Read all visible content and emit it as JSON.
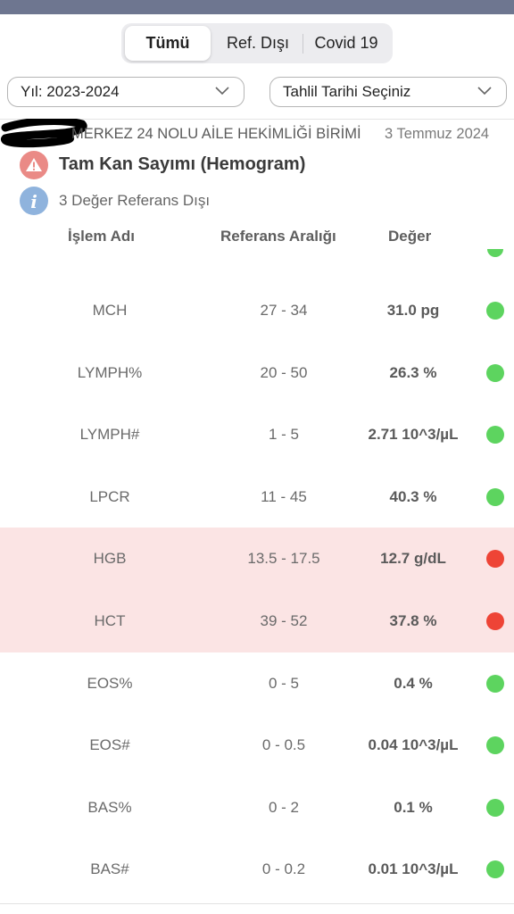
{
  "segments": [
    {
      "label": "Tümü",
      "active": true
    },
    {
      "label": "Ref. Dışı",
      "active": false
    },
    {
      "label": "Covid 19",
      "active": false
    }
  ],
  "filters": {
    "year": "Yıl: 2023-2024",
    "date": "Tahlil Tarihi Seçiniz"
  },
  "result": {
    "clinic": "MERKEZ 24 NOLU AİLE HEKİMLİĞİ BİRİMİ",
    "date": "3 Temmuz 2024",
    "test_name": "Tam Kan Sayımı (Hemogram)",
    "out_of_range_count": "3 Değer Referans Dışı"
  },
  "table": {
    "headers": [
      "İşlem Adı",
      "Referans Aralığı",
      "Değer"
    ],
    "rows": [
      {
        "name": "MCH",
        "range": "27 - 34",
        "value": "31.0 pg",
        "status": "normal"
      },
      {
        "name": "LYMPH%",
        "range": "20 - 50",
        "value": "26.3 %",
        "status": "normal"
      },
      {
        "name": "LYMPH#",
        "range": "1 - 5",
        "value": "2.71 10^3/µL",
        "status": "normal"
      },
      {
        "name": "LPCR",
        "range": "11 - 45",
        "value": "40.3 %",
        "status": "normal"
      },
      {
        "name": "HGB",
        "range": "13.5 - 17.5",
        "value": "12.7 g/dL",
        "status": "out"
      },
      {
        "name": "HCT",
        "range": "39 - 52",
        "value": "37.8 %",
        "status": "out"
      },
      {
        "name": "EOS%",
        "range": "0 - 5",
        "value": "0.4 %",
        "status": "normal"
      },
      {
        "name": "EOS#",
        "range": "0 - 0.5",
        "value": "0.04 10^3/µL",
        "status": "normal"
      },
      {
        "name": "BAS%",
        "range": "0 - 2",
        "value": "0.1 %",
        "status": "normal"
      },
      {
        "name": "BAS#",
        "range": "0 - 0.2",
        "value": "0.01 10^3/µL",
        "status": "normal"
      }
    ]
  },
  "colors": {
    "normal": "#5dd45f",
    "out": "#ee4436",
    "out_row_bg": "#fbe4e4",
    "warning": "#ea8a86",
    "info": "#8fb3dd"
  },
  "icons": [
    "warning-icon",
    "info-icon",
    "chevron-down-icon",
    "status-dot-icon"
  ]
}
